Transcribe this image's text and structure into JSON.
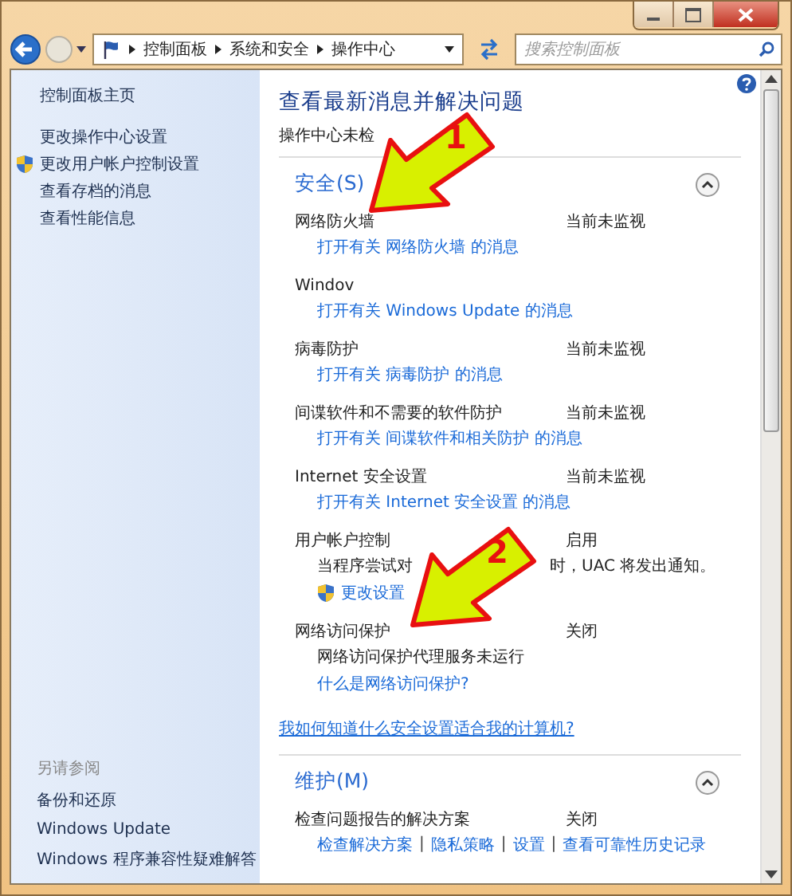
{
  "address_bar": {
    "breadcrumbs": [
      "控制面板",
      "系统和安全",
      "操作中心"
    ],
    "search": {
      "placeholder": "搜索控制面板"
    }
  },
  "sidebar": {
    "items": [
      {
        "label": "控制面板主页",
        "kind": "link"
      },
      {
        "label": "更改操作中心设置",
        "kind": "link"
      },
      {
        "label": "更改用户帐户控制设置",
        "kind": "shield-link"
      },
      {
        "label": "查看存档的消息",
        "kind": "link"
      },
      {
        "label": "查看性能信息",
        "kind": "link"
      }
    ],
    "see_also": {
      "title": "另请参阅",
      "items": [
        "备份和还原",
        "Windows Update",
        "Windows 程序兼容性疑难解答"
      ]
    }
  },
  "main": {
    "title": "查看最新消息并解决问题",
    "intro": "操作中心未检",
    "sections": [
      {
        "title": "安全(S)",
        "expanded": true,
        "rows": [
          {
            "name": "网络防火墙",
            "status": "当前未监视",
            "items": [
              {
                "kind": "link",
                "text": "打开有关 网络防火墙 的消息"
              }
            ]
          },
          {
            "name": "Windov",
            "items": [
              {
                "kind": "link",
                "text": "打开有关 Windows Update 的消息"
              }
            ]
          },
          {
            "name": "病毒防护",
            "status": "当前未监视",
            "items": [
              {
                "kind": "link",
                "text": "打开有关 病毒防护 的消息"
              }
            ]
          },
          {
            "name": "间谍软件和不需要的软件防护",
            "status": "当前未监视",
            "items": [
              {
                "kind": "link",
                "text": "打开有关 间谍软件和相关防护 的消息"
              }
            ]
          },
          {
            "name": "Internet 安全设置",
            "status": "当前未监视",
            "items": [
              {
                "kind": "link",
                "text": "打开有关 Internet 安全设置 的消息"
              }
            ]
          },
          {
            "name": "用户帐户控制",
            "status": "启用",
            "items": [
              {
                "kind": "covered-text",
                "parts": [
                  "当程序尝试对",
                  "时，UAC 将发出通知。"
                ]
              },
              {
                "kind": "shield-link",
                "text": "更改设置"
              }
            ]
          },
          {
            "name": "网络访问保护",
            "status": "关闭",
            "items": [
              {
                "kind": "text",
                "text": "网络访问保护代理服务未运行"
              },
              {
                "kind": "link",
                "text": "什么是网络访问保护?"
              }
            ]
          }
        ],
        "footer_link": "我如何知道什么安全设置适合我的计算机?"
      },
      {
        "title": "维护(M)",
        "expanded": true,
        "rows": [
          {
            "name": "检查问题报告的解决方案",
            "status": "关闭",
            "items": [
              {
                "kind": "links",
                "separator": "|",
                "links": [
                  "检查解决方案",
                  "隐私策略",
                  "设置",
                  "查看可靠性历史记录"
                ]
              }
            ]
          }
        ]
      }
    ]
  },
  "annotations": [
    {
      "number": "1"
    },
    {
      "number": "2"
    }
  ]
}
